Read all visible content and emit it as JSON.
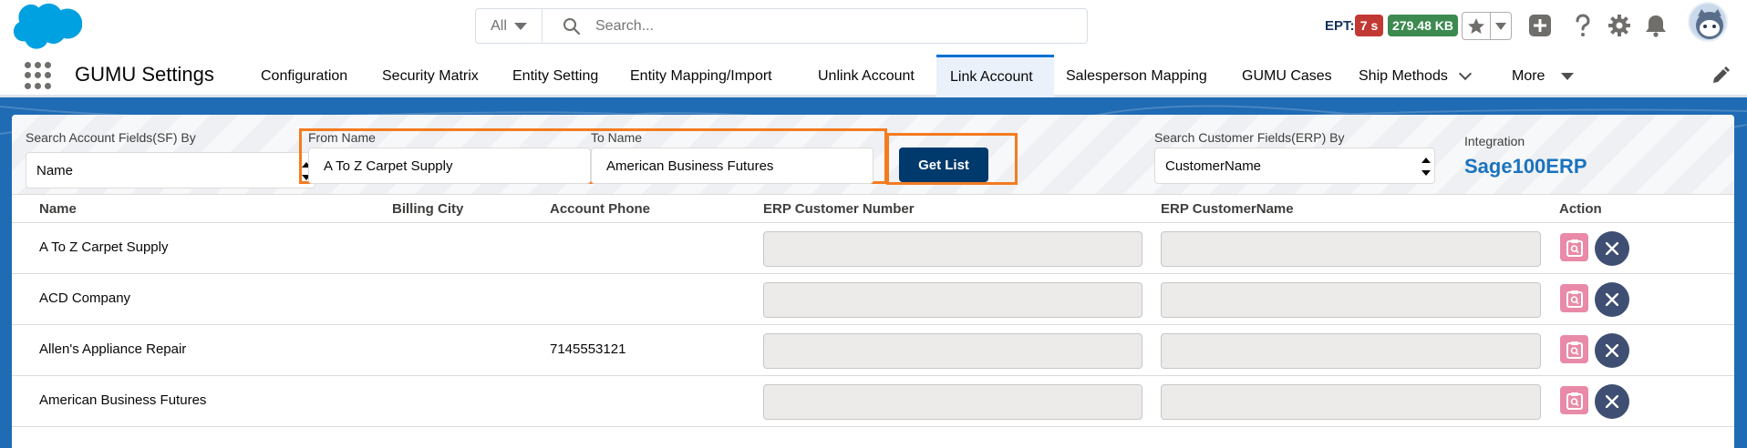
{
  "header": {
    "search_scope": "All",
    "search_placeholder": "Search...",
    "ept_label": "EPT:",
    "ept_time": "7 s",
    "ept_size": "279.48 KB"
  },
  "nav": {
    "app_name": "GUMU Settings",
    "tabs": [
      {
        "label": "Configuration"
      },
      {
        "label": "Security Matrix"
      },
      {
        "label": "Entity Setting"
      },
      {
        "label": "Entity Mapping/Import"
      },
      {
        "label": "Unlink Account"
      },
      {
        "label": "Link Account"
      },
      {
        "label": "Salesperson Mapping"
      },
      {
        "label": "GUMU Cases"
      },
      {
        "label": "Ship Methods"
      },
      {
        "label": "More"
      }
    ]
  },
  "filters": {
    "search_sf_label": "Search Account Fields(SF) By",
    "search_sf_value": "Name",
    "from_label": "From Name",
    "from_value": "A To Z Carpet Supply",
    "to_label": "To Name",
    "to_value": "American Business Futures",
    "get_list": "Get List",
    "search_erp_label": "Search Customer Fields(ERP) By",
    "search_erp_value": "CustomerName",
    "integration_label": "Integration",
    "integration_value": "Sage100ERP"
  },
  "table": {
    "columns": [
      "Name",
      "Billing City",
      "Account Phone",
      "ERP Customer Number",
      "ERP CustomerName",
      "Action"
    ],
    "rows": [
      {
        "name": "A To Z Carpet Supply",
        "city": "",
        "phone": ""
      },
      {
        "name": "ACD Company",
        "city": "",
        "phone": ""
      },
      {
        "name": "Allen's Appliance Repair",
        "city": "",
        "phone": "7145553121"
      },
      {
        "name": "American Business Futures",
        "city": "",
        "phone": ""
      }
    ]
  },
  "colors": {
    "brand_blue": "#00a1e0",
    "active_tab": "#0070d2",
    "highlight_orange": "#f47b20",
    "button_dark": "#00396b",
    "ept_red": "#c23934",
    "ept_green": "#3c8a4f"
  }
}
